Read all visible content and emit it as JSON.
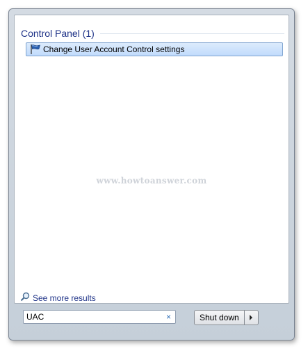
{
  "results": {
    "section_title": "Control Panel (1)",
    "items": [
      {
        "label": "Change User Account Control settings",
        "icon": "uac-flag-icon"
      }
    ]
  },
  "watermark": "www.howtoanswer.com",
  "see_more": {
    "label": "See more results",
    "icon": "search-icon"
  },
  "search": {
    "value": "UAC",
    "clear_icon": "×"
  },
  "power": {
    "shutdown_label": "Shut down",
    "arrow_icon": "chevron-right-icon"
  },
  "colors": {
    "link_blue": "#1e3287",
    "highlight": "#c1dbfc",
    "frame": "#c5cfd9"
  }
}
